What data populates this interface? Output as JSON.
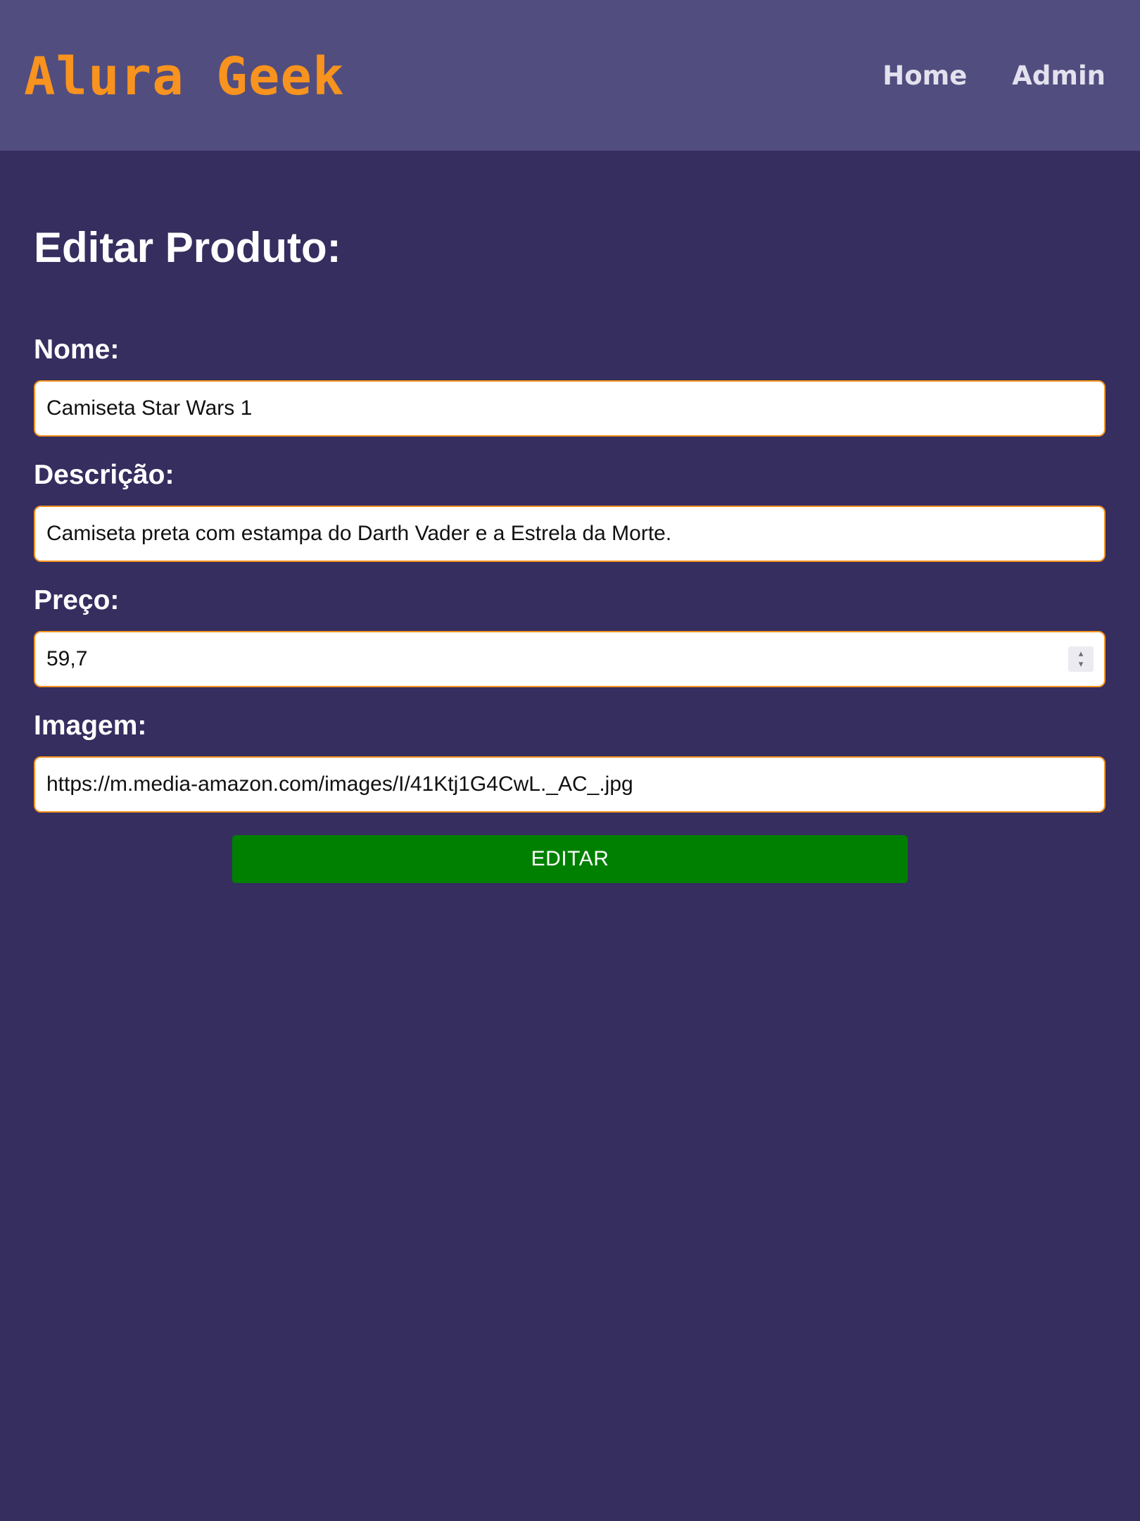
{
  "header": {
    "logo": "Alura Geek",
    "nav": [
      {
        "label": "Home"
      },
      {
        "label": "Admin"
      }
    ]
  },
  "main": {
    "title": "Editar Produto:",
    "fields": [
      {
        "label": "Nome:",
        "value": "Camiseta Star Wars 1"
      },
      {
        "label": "Descrição:",
        "value": "Camiseta preta com estampa do Darth Vader e a Estrela da Morte."
      },
      {
        "label": "Preço:",
        "value": "59,7"
      },
      {
        "label": "Imagem:",
        "value": "https://m.media-amazon.com/images/I/41Ktj1G4CwL._AC_.jpg"
      }
    ],
    "submit_label": "EDITAR"
  },
  "colors": {
    "header_bg": "#514d7f",
    "page_bg": "#352e5f",
    "logo": "#f7931e",
    "input_border": "#f7931e",
    "submit_bg": "#008000"
  },
  "icons": {
    "stepper_up": "▴",
    "stepper_down": "▾"
  }
}
